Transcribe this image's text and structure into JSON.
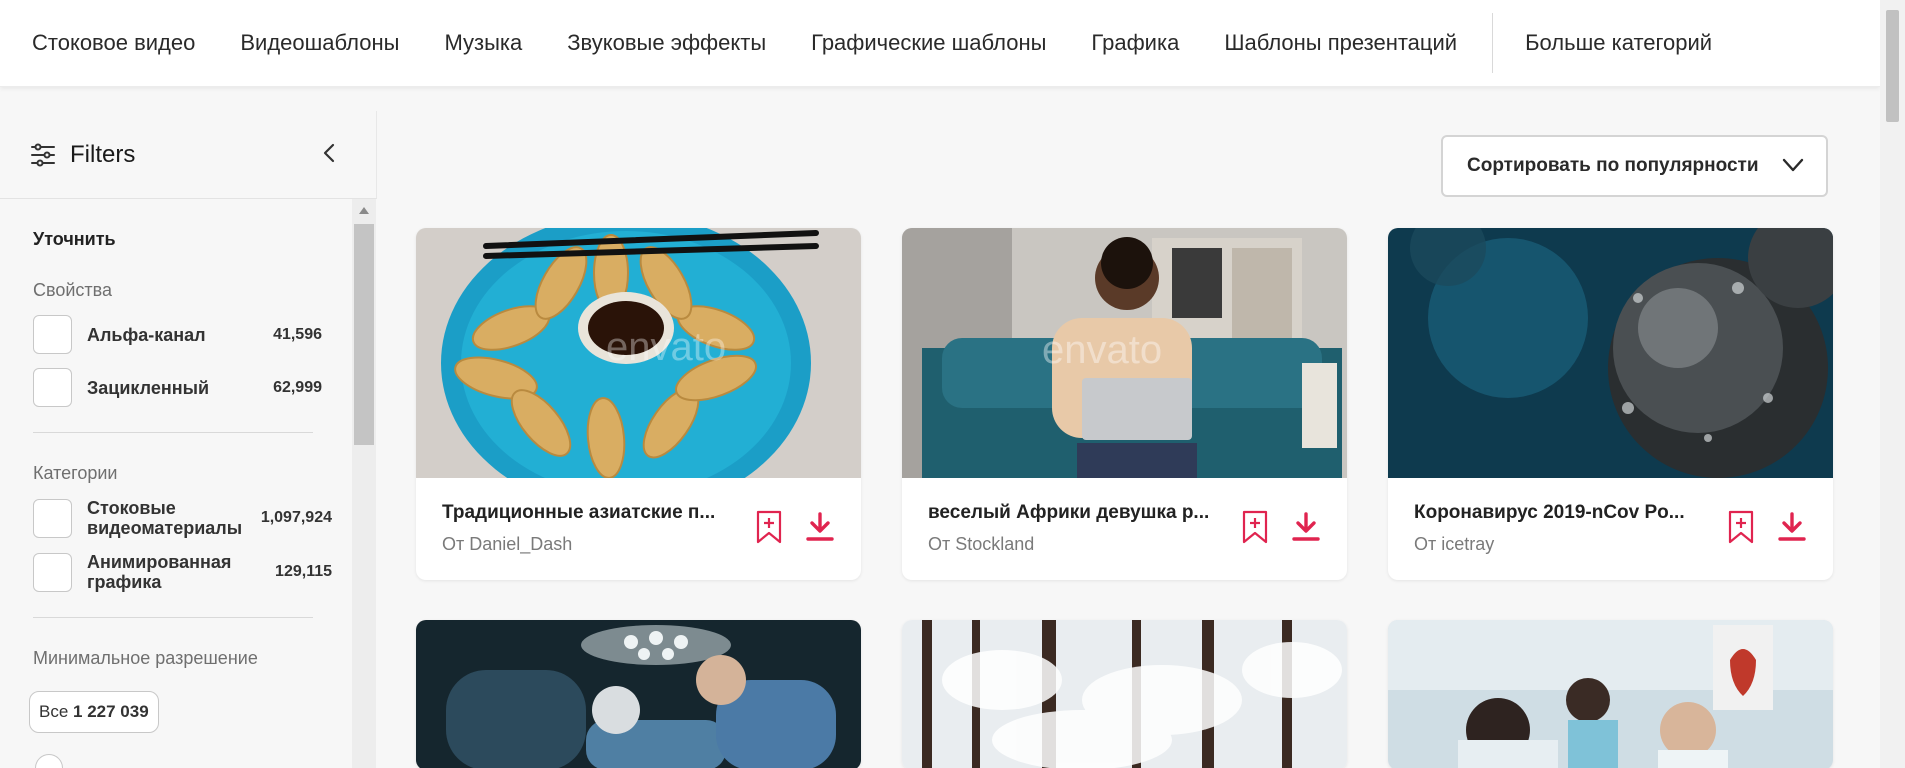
{
  "topnav": {
    "items": [
      "Стоковое видео",
      "Видеошаблоны",
      "Музыка",
      "Звуковые эффекты",
      "Графические шаблоны",
      "Графика",
      "Шаблоны презентаций"
    ],
    "more": "Больше категорий"
  },
  "sidebar": {
    "title": "Filters",
    "refine": "Уточнить",
    "properties": {
      "label": "Свойства",
      "options": [
        {
          "label": "Альфа-канал",
          "count": "41,596"
        },
        {
          "label": "Зацикленный",
          "count": "62,999"
        }
      ]
    },
    "categories": {
      "label": "Категории",
      "options": [
        {
          "label": "Стоковые видеоматериалы",
          "count": "1,097,924"
        },
        {
          "label": "Анимированная графика",
          "count": "129,115"
        }
      ]
    },
    "resolution": {
      "label": "Минимальное разрешение",
      "badge_prefix": "Все",
      "badge_value": "1 227 039"
    }
  },
  "sort": {
    "label": "Сортировать по популярности"
  },
  "watermark": "envato",
  "cards": [
    {
      "title": "Традиционные азиатские п...",
      "author": "От Daniel_Dash"
    },
    {
      "title": "веселый Африки девушка р...",
      "author": "От Stockland"
    },
    {
      "title": "Коронавирус 2019-nCov Po...",
      "author": "От icetray"
    }
  ],
  "colors": {
    "accent": "#e0244f",
    "bg": "#f7f7f7"
  },
  "icons": [
    "filter-sliders-icon",
    "chevron-left-icon",
    "chevron-down-icon",
    "bookmark-add-icon",
    "download-icon"
  ]
}
